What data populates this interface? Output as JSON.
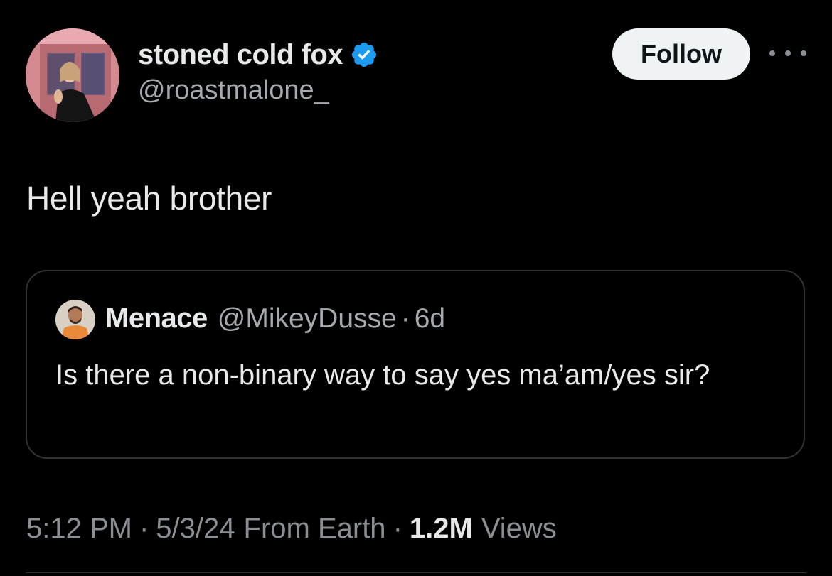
{
  "author": {
    "display_name": "stoned cold fox",
    "handle": "@roastmalone_",
    "verified": true
  },
  "follow_label": "Follow",
  "tweet_text": "Hell yeah brother",
  "quoted": {
    "display_name": "Menace",
    "handle": "@MikeyDusse",
    "separator": "·",
    "time": "6d",
    "text": "Is there a non-binary way to say yes ma’am/yes sir?"
  },
  "meta": {
    "time": "5:12 PM",
    "date": "5/3/24",
    "location": "From Earth",
    "separator": "·",
    "views_count": "1.2M",
    "views_label": "Views"
  },
  "colors": {
    "background": "#000000",
    "text_primary": "#e7e9ea",
    "text_secondary": "#8b8f94",
    "verified_blue": "#1d9bf0",
    "border": "#2f3336",
    "follow_bg": "#eff3f4"
  },
  "icons": {
    "verified": "verified-badge-icon",
    "more": "more-horizontal-icon"
  }
}
